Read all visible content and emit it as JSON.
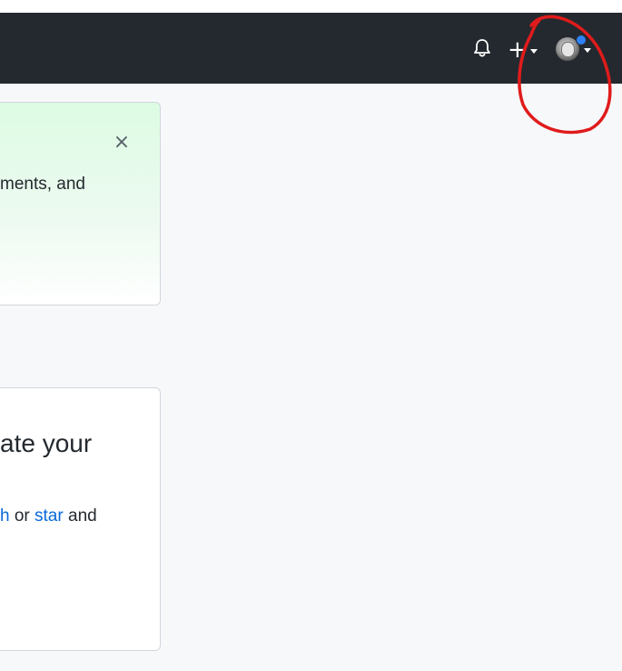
{
  "header": {
    "notifications_icon": "bell-icon",
    "create_icon": "plus-icon",
    "create_label": "+",
    "avatar_icon": "avatar",
    "unread_indicator_color": "#2f81f7"
  },
  "banner": {
    "close_label": "×",
    "text": "ments, and"
  },
  "card": {
    "title": "ate your",
    "body": {
      "link1": "h",
      "or": " or ",
      "link2": "star",
      "and": " and"
    }
  },
  "colors": {
    "header_bg": "#24292f",
    "page_bg": "#f6f8fa",
    "link": "#0969da",
    "annotation": "#e01b1b"
  }
}
